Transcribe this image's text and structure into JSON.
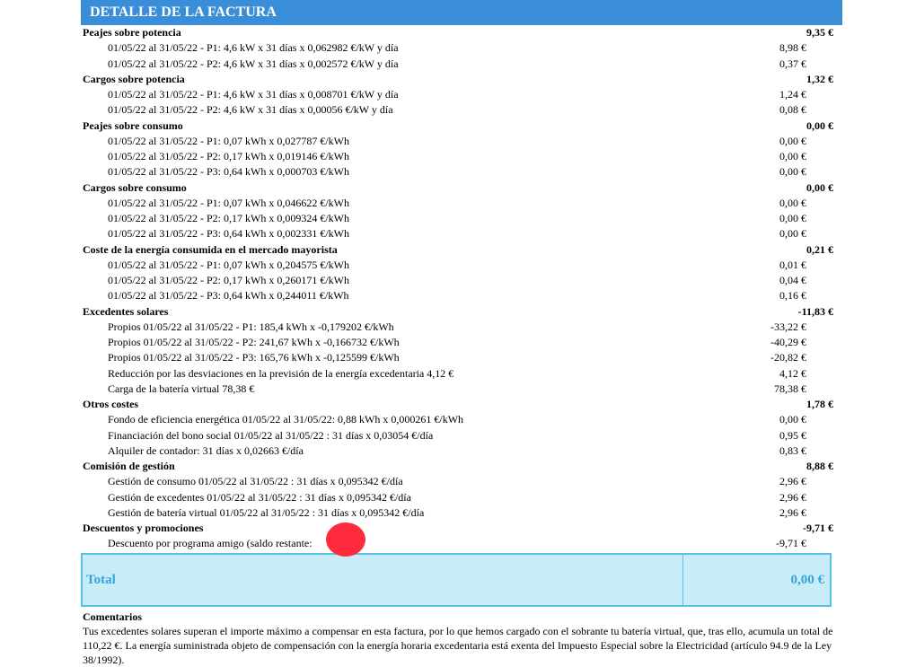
{
  "header": {
    "title": "DETALLE DE LA FACTURA"
  },
  "sections": [
    {
      "title": "Peajes sobre potencia",
      "amount": "9,35 €",
      "items": [
        {
          "label": "01/05/22 al 31/05/22 - P1: 4,6 kW x 31 días x 0,062982 €/kW y día",
          "amount": "8,98 €"
        },
        {
          "label": "01/05/22 al 31/05/22 - P2: 4,6 kW x 31 días x 0,002572 €/kW y día",
          "amount": "0,37 €"
        }
      ]
    },
    {
      "title": "Cargos sobre potencia",
      "amount": "1,32 €",
      "items": [
        {
          "label": "01/05/22 al 31/05/22 - P1: 4,6 kW x 31 días x 0,008701 €/kW y día",
          "amount": "1,24 €"
        },
        {
          "label": "01/05/22 al 31/05/22 - P2: 4,6 kW x 31 días x 0,00056 €/kW y día",
          "amount": "0,08 €"
        }
      ]
    },
    {
      "title": "Peajes sobre consumo",
      "amount": "0,00 €",
      "items": [
        {
          "label": "01/05/22 al 31/05/22 - P1: 0,07 kWh x 0,027787 €/kWh",
          "amount": "0,00 €"
        },
        {
          "label": "01/05/22 al 31/05/22 - P2: 0,17 kWh x 0,019146 €/kWh",
          "amount": "0,00 €"
        },
        {
          "label": "01/05/22 al 31/05/22 - P3: 0,64 kWh x 0,000703 €/kWh",
          "amount": "0,00 €"
        }
      ]
    },
    {
      "title": "Cargos sobre consumo",
      "amount": "0,00 €",
      "items": [
        {
          "label": "01/05/22 al 31/05/22 - P1: 0,07 kWh x 0,046622 €/kWh",
          "amount": "0,00 €"
        },
        {
          "label": "01/05/22 al 31/05/22 - P2: 0,17 kWh x 0,009324 €/kWh",
          "amount": "0,00 €"
        },
        {
          "label": "01/05/22 al 31/05/22 - P3: 0,64 kWh x 0,002331 €/kWh",
          "amount": "0,00 €"
        }
      ]
    },
    {
      "title": "Coste de la energía consumida en el mercado mayorista",
      "amount": "0,21 €",
      "items": [
        {
          "label": "01/05/22 al 31/05/22 - P1: 0,07 kWh x 0,204575 €/kWh",
          "amount": "0,01 €"
        },
        {
          "label": "01/05/22 al 31/05/22 - P2: 0,17 kWh x 0,260171 €/kWh",
          "amount": "0,04 €"
        },
        {
          "label": "01/05/22 al 31/05/22 - P3: 0,64 kWh x 0,244011 €/kWh",
          "amount": "0,16 €"
        }
      ]
    },
    {
      "title": "Excedentes solares",
      "amount": "-11,83 €",
      "items": [
        {
          "label": "Propios 01/05/22 al 31/05/22 - P1: 185,4 kWh x -0,179202 €/kWh",
          "amount": "-33,22 €"
        },
        {
          "label": "Propios 01/05/22 al 31/05/22 - P2: 241,67 kWh x -0,166732 €/kWh",
          "amount": "-40,29 €"
        },
        {
          "label": "Propios 01/05/22 al 31/05/22 - P3: 165,76 kWh x -0,125599 €/kWh",
          "amount": "-20,82 €"
        },
        {
          "label": "Reducción por las desviaciones en la previsión de la energía excedentaria 4,12 €",
          "amount": "4,12 €"
        },
        {
          "label": "Carga de la batería virtual 78,38 €",
          "amount": "78,38 €"
        }
      ]
    },
    {
      "title": "Otros costes",
      "amount": "1,78 €",
      "items": [
        {
          "label": "Fondo de eficiencia energética 01/05/22 al 31/05/22: 0,88 kWh x 0,000261 €/kWh",
          "amount": "0,00 €"
        },
        {
          "label": "Financiación del bono social 01/05/22 al 31/05/22 : 31 días x 0,03054 €/día",
          "amount": "0,95 €"
        },
        {
          "label": "Alquiler de contador: 31 días x 0,02663 €/día",
          "amount": "0,83 €"
        }
      ]
    },
    {
      "title": "Comisión de gestión",
      "amount": "8,88 €",
      "items": [
        {
          "label": "Gestión de consumo 01/05/22 al 31/05/22 : 31 días x 0,095342 €/día",
          "amount": "2,96 €"
        },
        {
          "label": "Gestión de excedentes 01/05/22 al 31/05/22 : 31 días x 0,095342 €/día",
          "amount": "2,96 €"
        },
        {
          "label": "Gestión de batería virtual 01/05/22 al 31/05/22 : 31 días x 0,095342 €/día",
          "amount": "2,96 €"
        }
      ]
    },
    {
      "title": "Descuentos y promociones",
      "amount": "-9,71 €",
      "items": [
        {
          "label": "Descuento por programa amigo (saldo restante: ",
          "amount": "-9,71 €"
        }
      ]
    }
  ],
  "total": {
    "label": "Total",
    "amount": "0,00 €"
  },
  "comments": {
    "title": "Comentarios",
    "text": "Tus excedentes solares superan el importe máximo a compensar en esta factura, por lo que hemos cargado con el sobrante tu batería virtual, que, tras ello, acumula un total de 110,22 €. La energía suministrada objeto de compensación con la energía horaria excedentaria está exenta del Impuesto Especial sobre la Electricidad (artículo 94.9 de la Ley 38/1992)."
  },
  "colors": {
    "header_bg": "#3a8ed8",
    "total_bg": "#c8ecf8",
    "total_text": "#36a3d9",
    "redaction": "#ff2a3b"
  }
}
